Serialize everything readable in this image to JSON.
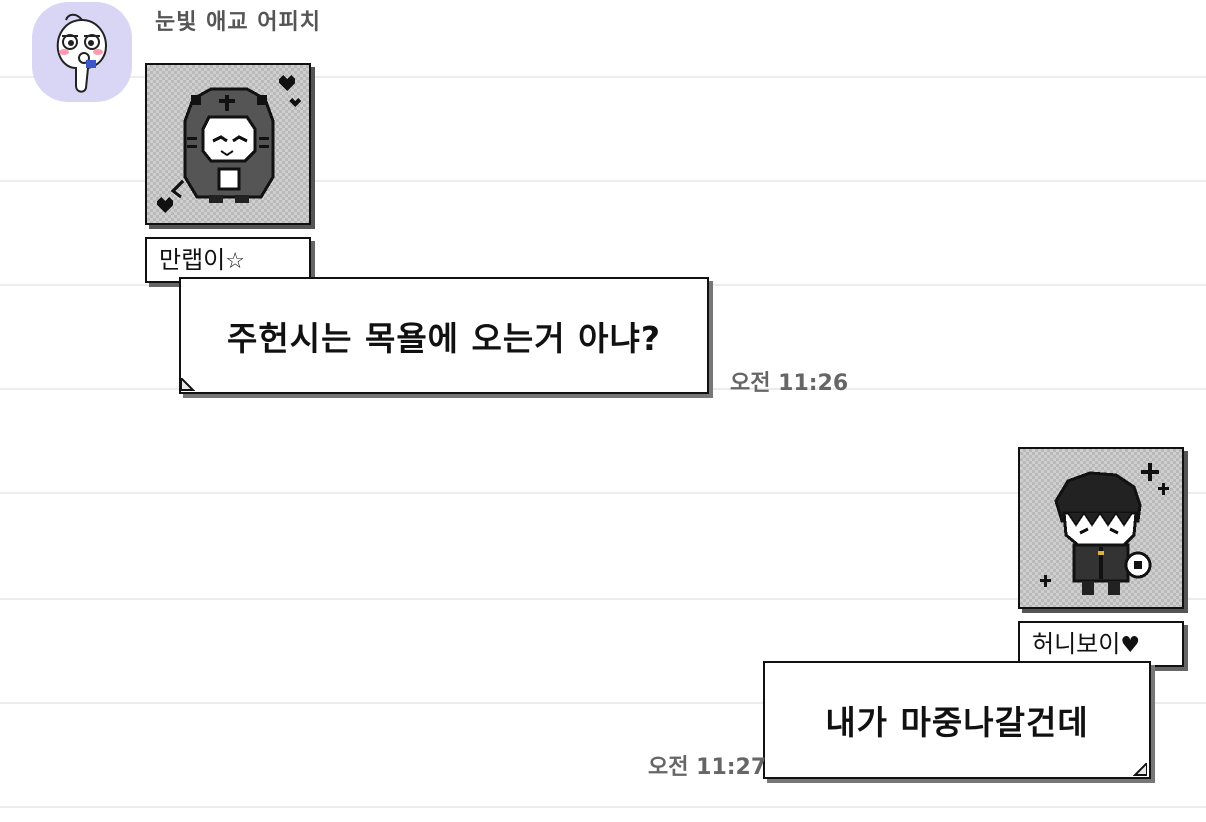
{
  "chat": {
    "incoming": {
      "sender_name": "눈빛 애교 어피치",
      "avatar_icon": "apeach-avatar-icon",
      "sticker_icon": "pixel-hooded-cat-sticker-icon",
      "name_tag": "만랩이",
      "name_tag_symbol": "☆",
      "message": "주헌시는 목욜에 오는거 아냐?",
      "time": "오전 11:26"
    },
    "outgoing": {
      "sticker_icon": "pixel-boy-sticker-icon",
      "name_tag": "허니보이",
      "name_tag_symbol": "♥",
      "message": "내가 마중나갈건데",
      "time": "오전 11:27"
    }
  },
  "colors": {
    "background": "#ffffff",
    "rule_line": "#ececec",
    "avatar_bg": "#d9d6f5",
    "border": "#111111",
    "shadow": "#666666",
    "timestamp": "#666666",
    "sender_name": "#555555"
  }
}
